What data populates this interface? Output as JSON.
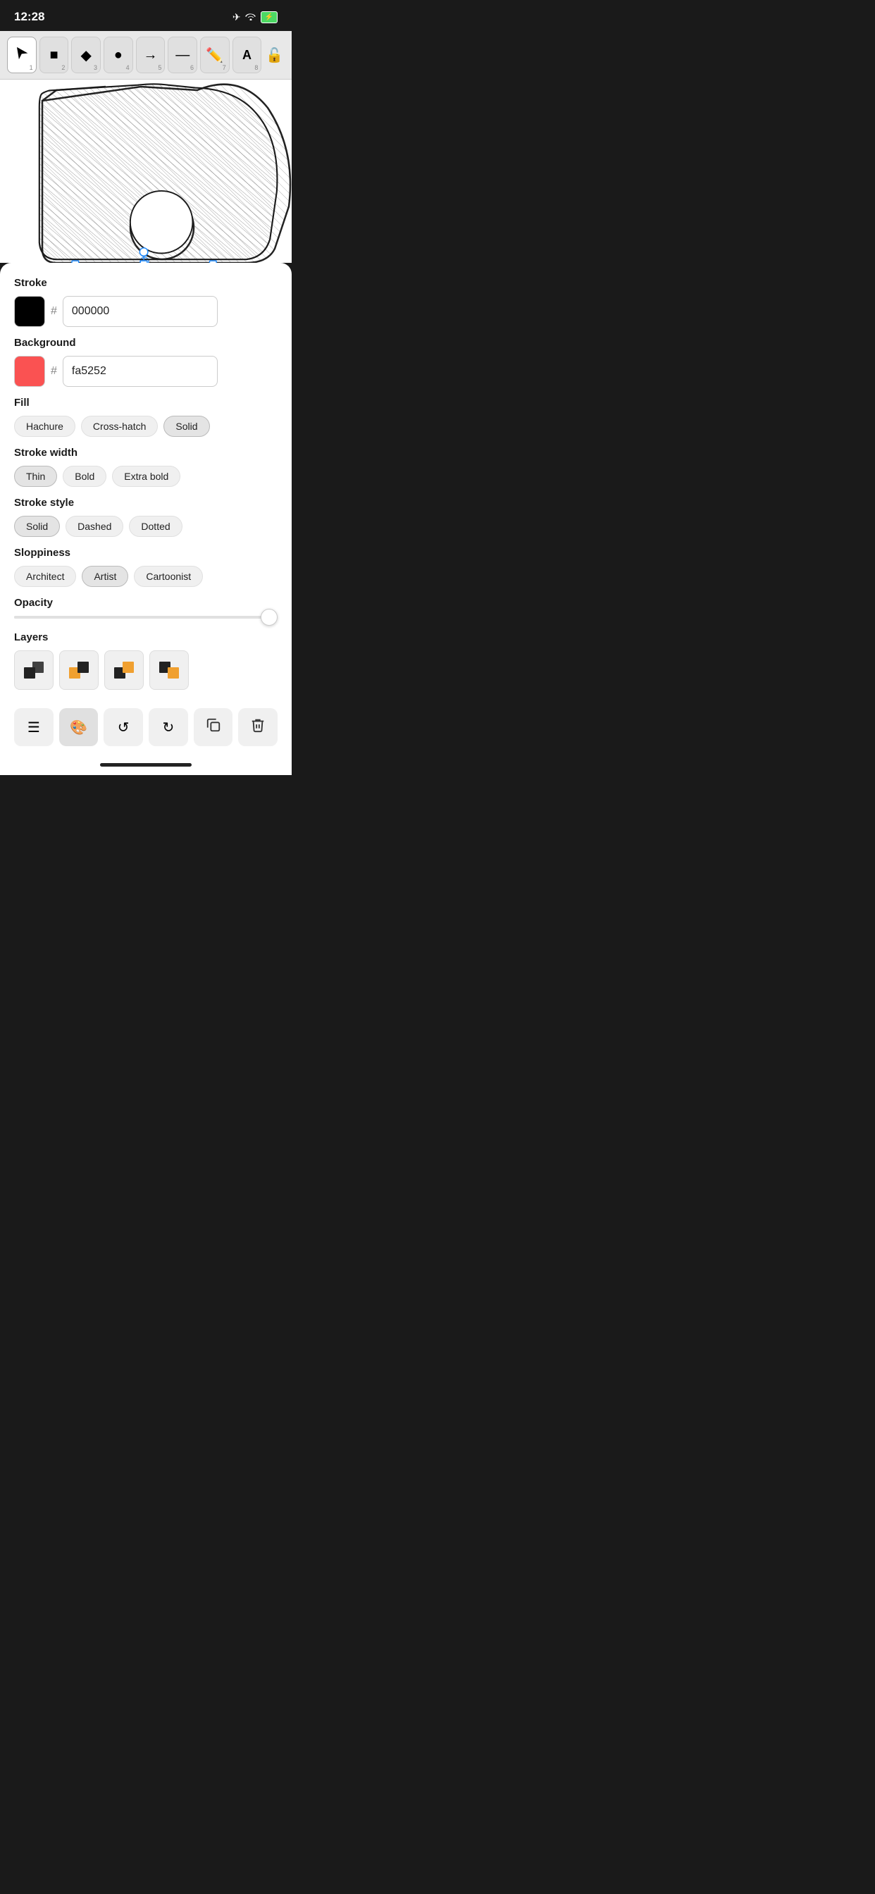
{
  "statusBar": {
    "time": "12:28",
    "icons": [
      "airplane",
      "wifi",
      "battery"
    ]
  },
  "toolbar": {
    "tools": [
      {
        "id": "select",
        "symbol": "▲",
        "num": "1",
        "active": false
      },
      {
        "id": "rectangle",
        "symbol": "■",
        "num": "2",
        "active": false
      },
      {
        "id": "diamond",
        "symbol": "◆",
        "num": "3",
        "active": false
      },
      {
        "id": "ellipse",
        "symbol": "●",
        "num": "4",
        "active": false
      },
      {
        "id": "arrow",
        "symbol": "→",
        "num": "5",
        "active": false
      },
      {
        "id": "line",
        "symbol": "—",
        "num": "6",
        "active": false
      },
      {
        "id": "pencil",
        "symbol": "✏",
        "num": "7",
        "active": false
      },
      {
        "id": "text",
        "symbol": "A",
        "num": "8",
        "active": false
      }
    ],
    "lockSymbol": "🔓"
  },
  "canvas": {
    "label": "Floppy",
    "sketchStyle": "hachure"
  },
  "panel": {
    "stroke": {
      "label": "Stroke",
      "color": "#000000",
      "hexValue": "000000"
    },
    "background": {
      "label": "Background",
      "color": "#fa5252",
      "hexValue": "fa5252"
    },
    "fill": {
      "label": "Fill",
      "options": [
        "Hachure",
        "Cross-hatch",
        "Solid"
      ],
      "active": "Solid"
    },
    "strokeWidth": {
      "label": "Stroke width",
      "options": [
        "Thin",
        "Bold",
        "Extra bold"
      ],
      "active": "Thin"
    },
    "strokeStyle": {
      "label": "Stroke style",
      "options": [
        "Solid",
        "Dashed",
        "Dotted"
      ],
      "active": "Solid"
    },
    "sloppiness": {
      "label": "Sloppiness",
      "options": [
        "Architect",
        "Artist",
        "Cartoonist"
      ],
      "active": "Artist"
    },
    "opacity": {
      "label": "Opacity",
      "value": 100
    },
    "layers": {
      "label": "Layers"
    }
  },
  "actionBar": {
    "buttons": [
      {
        "id": "menu",
        "symbol": "☰",
        "active": false
      },
      {
        "id": "palette",
        "symbol": "🎨",
        "active": true
      },
      {
        "id": "undo",
        "symbol": "↺",
        "active": false
      },
      {
        "id": "redo",
        "symbol": "↻",
        "active": false
      },
      {
        "id": "copy",
        "symbol": "⧉",
        "active": false
      },
      {
        "id": "delete",
        "symbol": "🗑",
        "active": false
      }
    ]
  }
}
